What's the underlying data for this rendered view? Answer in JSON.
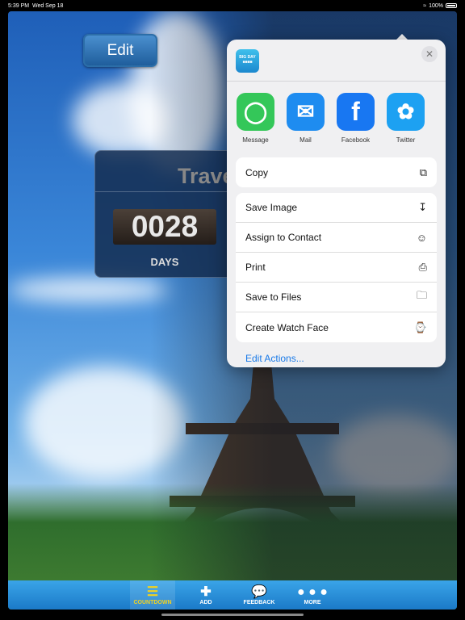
{
  "status": {
    "time": "5:39 PM",
    "date": "Wed Sep 18",
    "battery": "100%"
  },
  "app": {
    "edit_label": "Edit",
    "countdown_title": "Trave",
    "countdown_value": "0028",
    "countdown_unit": "DAYS"
  },
  "tabbar": [
    {
      "label": "COUNTDOWN",
      "icon": "list-icon",
      "active": true
    },
    {
      "label": "ADD",
      "icon": "plus-icon"
    },
    {
      "label": "FEEDBACK",
      "icon": "speech-bubble-icon"
    },
    {
      "label": "MORE",
      "icon": "more-dots-icon"
    }
  ],
  "share": {
    "app_icon_text": "BIG DAY",
    "apps": [
      {
        "label": "Message",
        "color": "#34c759"
      },
      {
        "label": "Mail",
        "color": "#1e8cf0"
      },
      {
        "label": "Facebook",
        "color": "#1877f2"
      },
      {
        "label": "Twitter",
        "color": "#1da1f2"
      }
    ],
    "copy": "Copy",
    "actions": [
      {
        "label": "Save Image",
        "icon": "download-icon"
      },
      {
        "label": "Assign to Contact",
        "icon": "contact-icon"
      },
      {
        "label": "Print",
        "icon": "printer-icon"
      },
      {
        "label": "Save to Files",
        "icon": "folder-icon"
      },
      {
        "label": "Create Watch Face",
        "icon": "watch-icon"
      }
    ],
    "edit_actions": "Edit Actions..."
  }
}
